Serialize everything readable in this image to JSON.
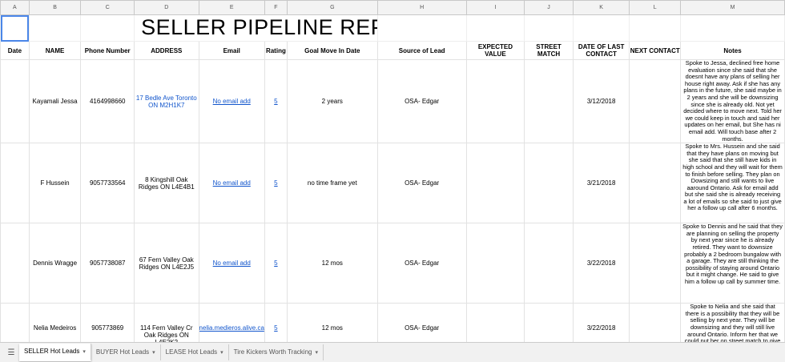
{
  "title": "SELLER PIPELINE REPORT",
  "column_letters": [
    "A",
    "B",
    "C",
    "D",
    "E",
    "F",
    "G",
    "H",
    "I",
    "J",
    "K",
    "L",
    "M"
  ],
  "headers": {
    "date": "Date",
    "name": "NAME",
    "phone": "Phone Number",
    "address": "ADDRESS",
    "email": "Email",
    "rating": "Rating",
    "goal": "Goal Move In Date",
    "source": "Source of Lead",
    "expected": "EXPECTED VALUE",
    "street": "STREET MATCH",
    "last_contact": "DATE OF LAST CONTACT",
    "next_contact": "NEXT CONTACT",
    "notes": "Notes"
  },
  "rows": [
    {
      "name": "Kayamali Jessa",
      "phone": "4164998660",
      "address": "17 Bedle Ave Toronto ON M2H1K7",
      "email": "No email add",
      "rating": "5",
      "goal": "2 years",
      "source": "OSA- Edgar",
      "last_contact": "3/12/2018",
      "notes": "Spoke to Jessa, declined free home evaluation since she said that she doesnt have any plans of selling her house right away. Ask if she has any plans in the future, she said maybe in 2 years and she will be downsizing since she is already old. Not yet decided where to move next. Told her we could keep in touch and said her updates on her email, but She has ni email add. Will touch base after 2 months."
    },
    {
      "name": "F Hussein",
      "phone": "9057733564",
      "address": "8 Kingshill Oak Ridges ON L4E4B1",
      "email": "No email add",
      "rating": "5",
      "goal": "no time frame yet",
      "source": "OSA- Edgar",
      "last_contact": "3/21/2018",
      "notes": "Spoke to Mrs. Hussein and she said that they have plans on moving but she said that she still have kids in high school and they will wait for them to finish before selling. They plan on Dowsizing and still wants to live aaround Ontario. Ask for email add but she said she is already receiving a lot of emails so she said to just give her a follow up call after 6 months."
    },
    {
      "name": "Dennis Wragge",
      "phone": "9057738087",
      "address": "67 Fern Valley Oak Ridges ON L4E2J5",
      "email": "No email add",
      "rating": "5",
      "goal": "12 mos",
      "source": "OSA- Edgar",
      "last_contact": "3/22/2018",
      "notes": "Spoke to Dennis and he said that they are planning on selling the property by next year since he is already retired. They want to downsize probably a 2 bedroom bungalow with a garage. They are still thinking the possibility of staying around Ontario but it might change. He said to give him a follow up call by summer time."
    },
    {
      "name": "Nelia Medeiros",
      "phone": "905773869",
      "address": "114 Fern Valley Cr Oak Ridges ON L4E2K2",
      "email": "nelia.medieros.alive.ca",
      "rating": "5",
      "goal": "12 mos",
      "source": "OSA- Edgar",
      "last_contact": "3/22/2018",
      "notes": "Spoke to Nelia and she said that there is a possibility that they will be selling by next year. They will be downsizing and they will still live around Ontario. Inform her that we could put her on street match to give her updates abo"
    }
  ],
  "tabs": [
    {
      "label": "SELLER Hot Leads",
      "active": true
    },
    {
      "label": "BUYER Hot Leads",
      "active": false
    },
    {
      "label": "LEASE Hot Leads",
      "active": false
    },
    {
      "label": "Tire Kickers Worth Tracking",
      "active": false
    }
  ],
  "icons": {
    "sheets_menu": "hamburger-icon",
    "tab_menu": "caret-down-icon"
  },
  "colors": {
    "link": "#1155cc",
    "selection": "#4a86e8"
  }
}
